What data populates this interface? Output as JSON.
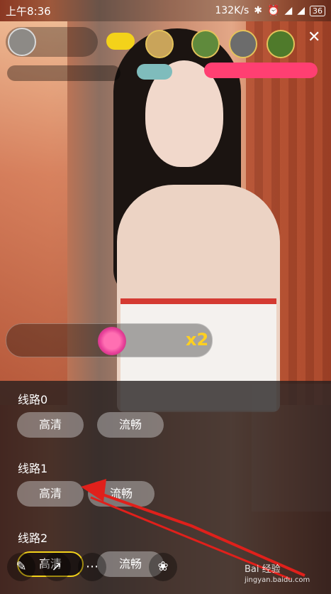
{
  "status_bar": {
    "time": "上午8:36",
    "speed": "132K/s",
    "battery": "36"
  },
  "sheet": {
    "routes": [
      {
        "title": "线路0",
        "buttons": [
          "高清",
          "流畅"
        ]
      },
      {
        "title": "线路1",
        "buttons": [
          "高清",
          "流畅"
        ]
      },
      {
        "title": "线路2",
        "buttons": [
          "高清",
          "流畅"
        ]
      }
    ],
    "selected": {
      "route": 2,
      "button": 0
    }
  },
  "gift": {
    "count": "x2"
  },
  "close_icon": "close-icon",
  "colors": {
    "highlight": "#f3d21a",
    "arrow": "#e0201b",
    "accent_pink": "#ff3f72"
  },
  "watermark": {
    "brand": "Bai 经验",
    "url": "jingyan.baidu.com"
  }
}
